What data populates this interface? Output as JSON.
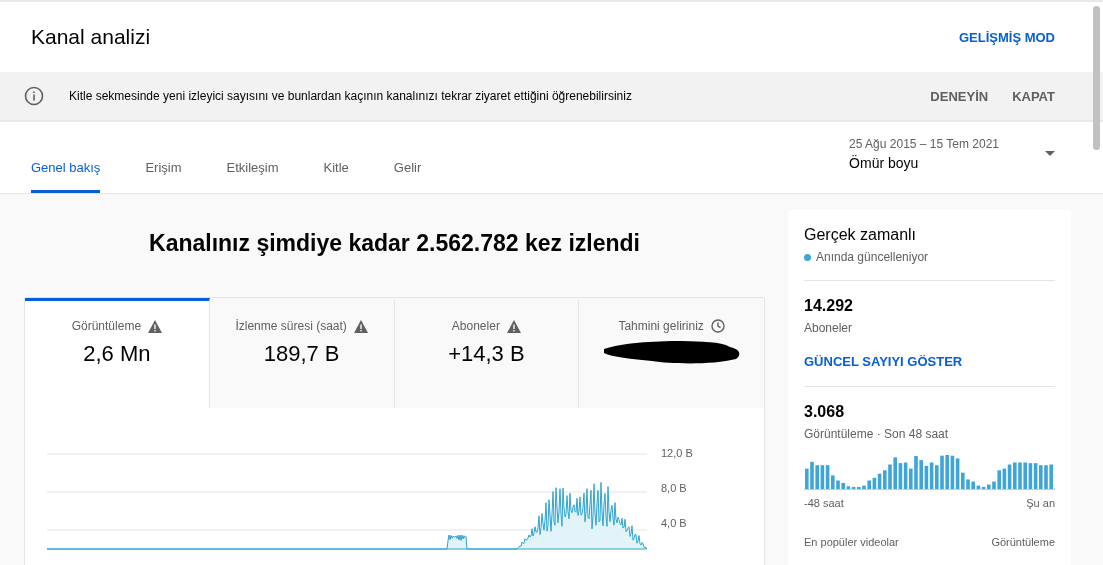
{
  "header": {
    "title": "Kanal analizi",
    "advanced_mode": "GELİŞMİŞ MOD"
  },
  "banner": {
    "message": "Kitle sekmesinde yeni izleyici sayısını ve bunlardan kaçının kanalınızı tekrar ziyaret ettiğini öğrenebilirsiniz",
    "actions": [
      "DENEYİN",
      "KAPAT"
    ]
  },
  "tabs": [
    {
      "label": "Genel bakış",
      "selected": true
    },
    {
      "label": "Erişim",
      "selected": false
    },
    {
      "label": "Etkileşim",
      "selected": false
    },
    {
      "label": "Kitle",
      "selected": false
    },
    {
      "label": "Gelir",
      "selected": false
    }
  ],
  "date_range": {
    "range": "25 Ağu 2015 – 15 Tem 2021",
    "period": "Ömür boyu"
  },
  "headline": "Kanalınız şimdiye kadar 2.562.782 kez izlendi",
  "metrics": [
    {
      "label": "Görüntüleme",
      "value": "2,6 Mn",
      "kind": "warning",
      "selected": true
    },
    {
      "label": "İzlenme süresi (saat)",
      "value": "189,7 B",
      "kind": "warning",
      "selected": false
    },
    {
      "label": "Aboneler",
      "value": "+14,3 B",
      "kind": "warning",
      "selected": false
    },
    {
      "label": "Tahmini geliriniz",
      "kind": "redacted",
      "selected": false
    }
  ],
  "chart": {
    "y_tick_labels": [
      "12,0 B",
      "8,0 B",
      "4,0 B"
    ]
  },
  "realtime": {
    "title": "Gerçek zamanlı",
    "status": "Anında güncelleniyor",
    "subscribers": "14.292",
    "subscribers_label": "Aboneler",
    "show_count": "GÜNCEL SAYIYI GÖSTER",
    "views": "3.068",
    "views_label": "Görüntüleme · Son 48 saat",
    "axis_start": "-48 saat",
    "axis_end": "Şu an",
    "top_videos_label": "En popüler videolar",
    "top_videos_metric": "Görüntüleme"
  }
}
